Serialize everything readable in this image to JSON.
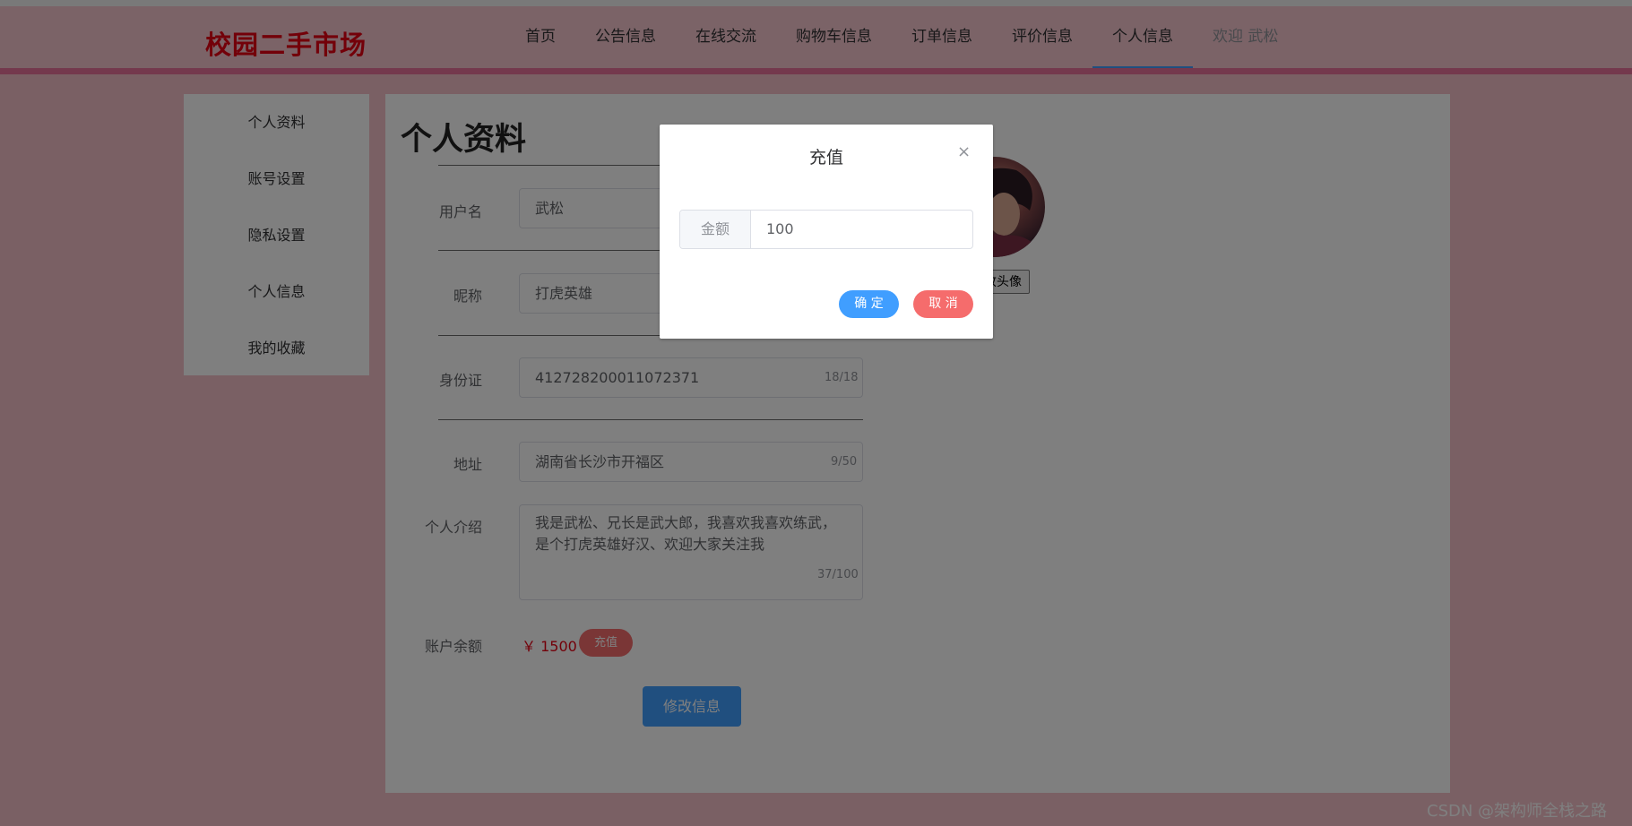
{
  "header": {
    "logo": "校园二手市场",
    "nav": [
      {
        "label": "首页"
      },
      {
        "label": "公告信息"
      },
      {
        "label": "在线交流"
      },
      {
        "label": "购物车信息"
      },
      {
        "label": "订单信息"
      },
      {
        "label": "评价信息"
      },
      {
        "label": "个人信息",
        "active": true
      }
    ],
    "welcome": "欢迎 武松"
  },
  "sidebar": {
    "items": [
      {
        "label": "个人资料"
      },
      {
        "label": "账号设置"
      },
      {
        "label": "隐私设置"
      },
      {
        "label": "个人信息"
      },
      {
        "label": "我的收藏"
      }
    ]
  },
  "profile": {
    "title": "个人资料",
    "username_label": "用户名",
    "username_value": "武松",
    "nickname_label": "昵称",
    "nickname_value": "打虎英雄",
    "idcard_label": "身份证",
    "idcard_value": "412728200011072371",
    "idcard_count": "18/18",
    "address_label": "地址",
    "address_value": "湖南省长沙市开福区",
    "address_count": "9/50",
    "intro_label": "个人介绍",
    "intro_value": "我是武松、兄长是武大郎，我喜欢我喜欢练武，是个打虎英雄好汉、欢迎大家关注我",
    "intro_count": "37/100",
    "balance_label": "账户余额",
    "balance_value": "￥ 1500",
    "recharge_label": "充值",
    "modify_label": "修改信息",
    "avatar_button": "改头像"
  },
  "dialog": {
    "title": "充值",
    "amount_label": "金额",
    "amount_value": "100",
    "ok_label": "确 定",
    "cancel_label": "取 消",
    "close_icon": "×"
  },
  "watermark": "CSDN @架构师全栈之路",
  "colors": {
    "accent": "#409eff",
    "danger": "#f56c6c",
    "logo": "#e60012",
    "header_bg": "#f6c6cf"
  }
}
